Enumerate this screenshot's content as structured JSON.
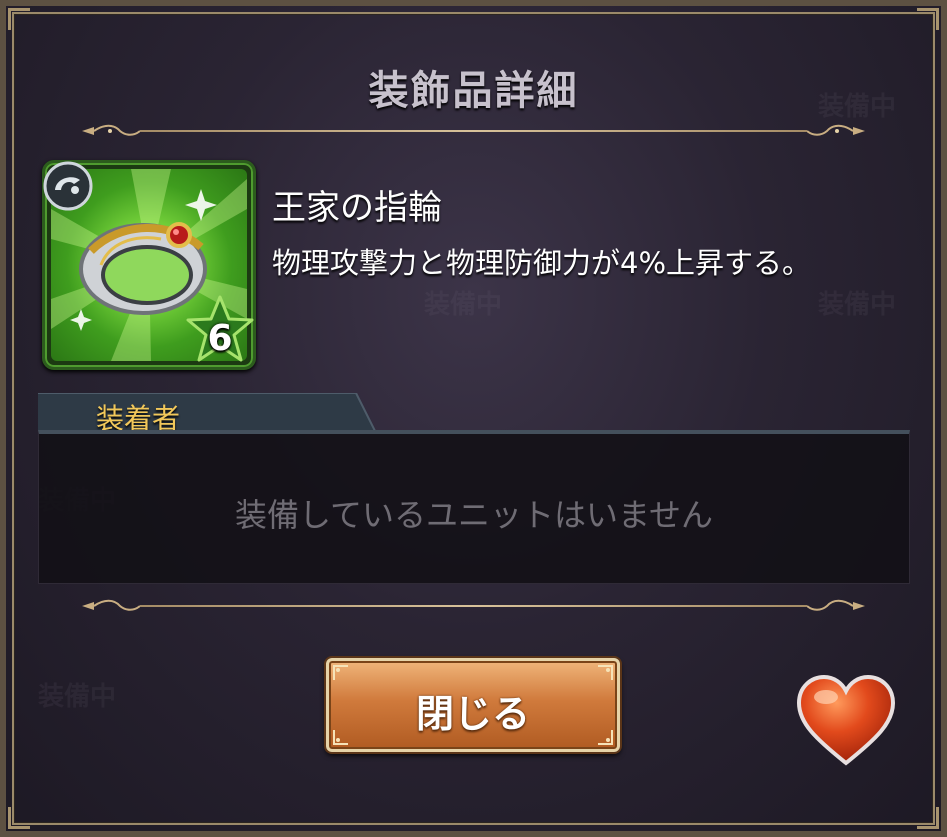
{
  "dialog": {
    "title": "装飾品詳細",
    "item": {
      "name": "王家の指輪",
      "description": "物理攻撃力と物理防御力が4%上昇する。",
      "rarity": "6",
      "icon": "ring-icon",
      "frame_color": "#3f9d1e"
    },
    "equipper": {
      "tab_label": "装着者",
      "empty_message": "装備しているユニットはいません"
    },
    "close_button_label": "閉じる",
    "favorite_icon": "heart-icon"
  },
  "background_ghosts": [
    "装備中",
    "装備中",
    "装備中",
    "装備中",
    "装備中"
  ],
  "colors": {
    "accent_gold": "#f2c85a",
    "button_orange": "#d07a3c",
    "heart_red": "#e24a1c"
  }
}
